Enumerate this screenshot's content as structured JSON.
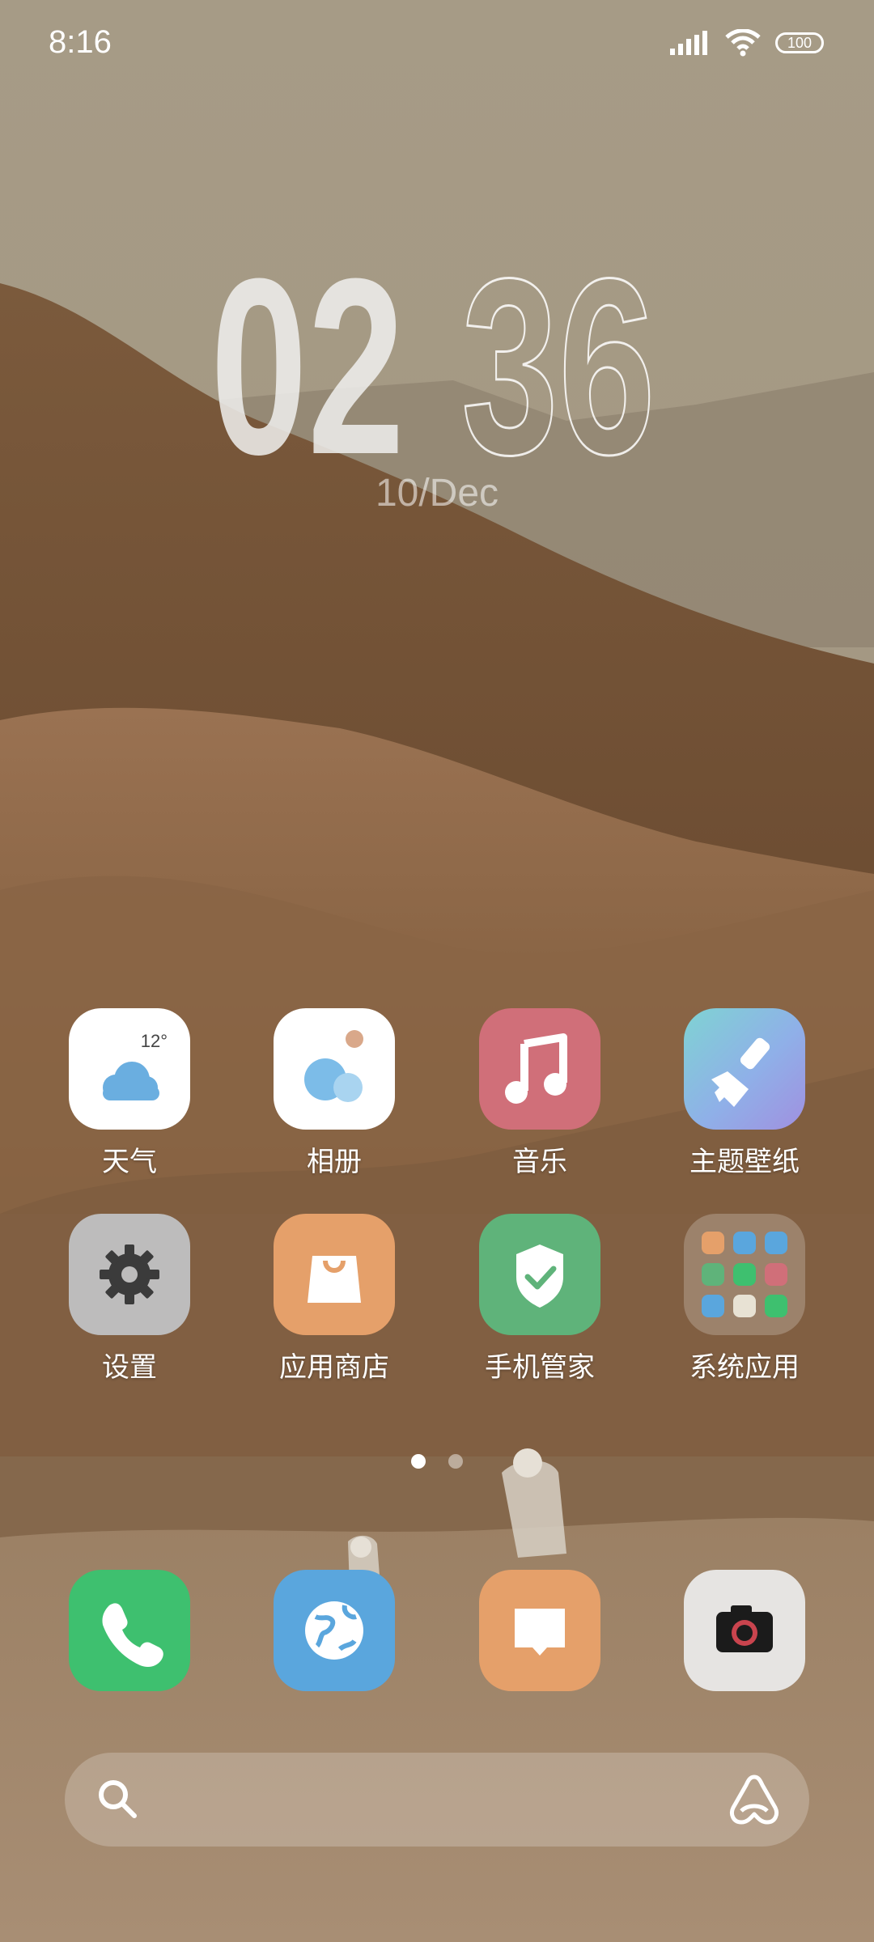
{
  "status_bar": {
    "time": "8:16",
    "battery": "100",
    "icons": [
      "signal-icon",
      "wifi-icon",
      "battery-icon"
    ]
  },
  "clock": {
    "hours": "02",
    "minutes": "36",
    "date": "10/Dec"
  },
  "apps": [
    {
      "name": "天气",
      "icon": "weather-icon",
      "temp": "12°",
      "color": "#ffffff"
    },
    {
      "name": "相册",
      "icon": "gallery-icon",
      "color": "#ffffff"
    },
    {
      "name": "音乐",
      "icon": "music-icon",
      "color": "#d06f79"
    },
    {
      "name": "主题壁纸",
      "icon": "themes-icon",
      "color": "#7cc8dc"
    },
    {
      "name": "设置",
      "icon": "gear-icon",
      "color": "#bdbcbc"
    },
    {
      "name": "应用商店",
      "icon": "store-icon",
      "color": "#e5a06a"
    },
    {
      "name": "手机管家",
      "icon": "security-icon",
      "color": "#5fb37a"
    },
    {
      "name": "系统应用",
      "icon": "folder-icon",
      "color": "rgba(255,255,255,0.25)"
    }
  ],
  "page_indicator": {
    "pages": 2,
    "active": 0
  },
  "dock": [
    {
      "icon": "phone-icon",
      "color": "#3ec06f"
    },
    {
      "icon": "browser-icon",
      "color": "#5aa6dd"
    },
    {
      "icon": "messages-icon",
      "color": "#e5a06a"
    },
    {
      "icon": "camera-icon",
      "color": "#e6e4e2"
    }
  ],
  "search": {
    "icons": [
      "search-icon",
      "assistant-icon"
    ]
  }
}
